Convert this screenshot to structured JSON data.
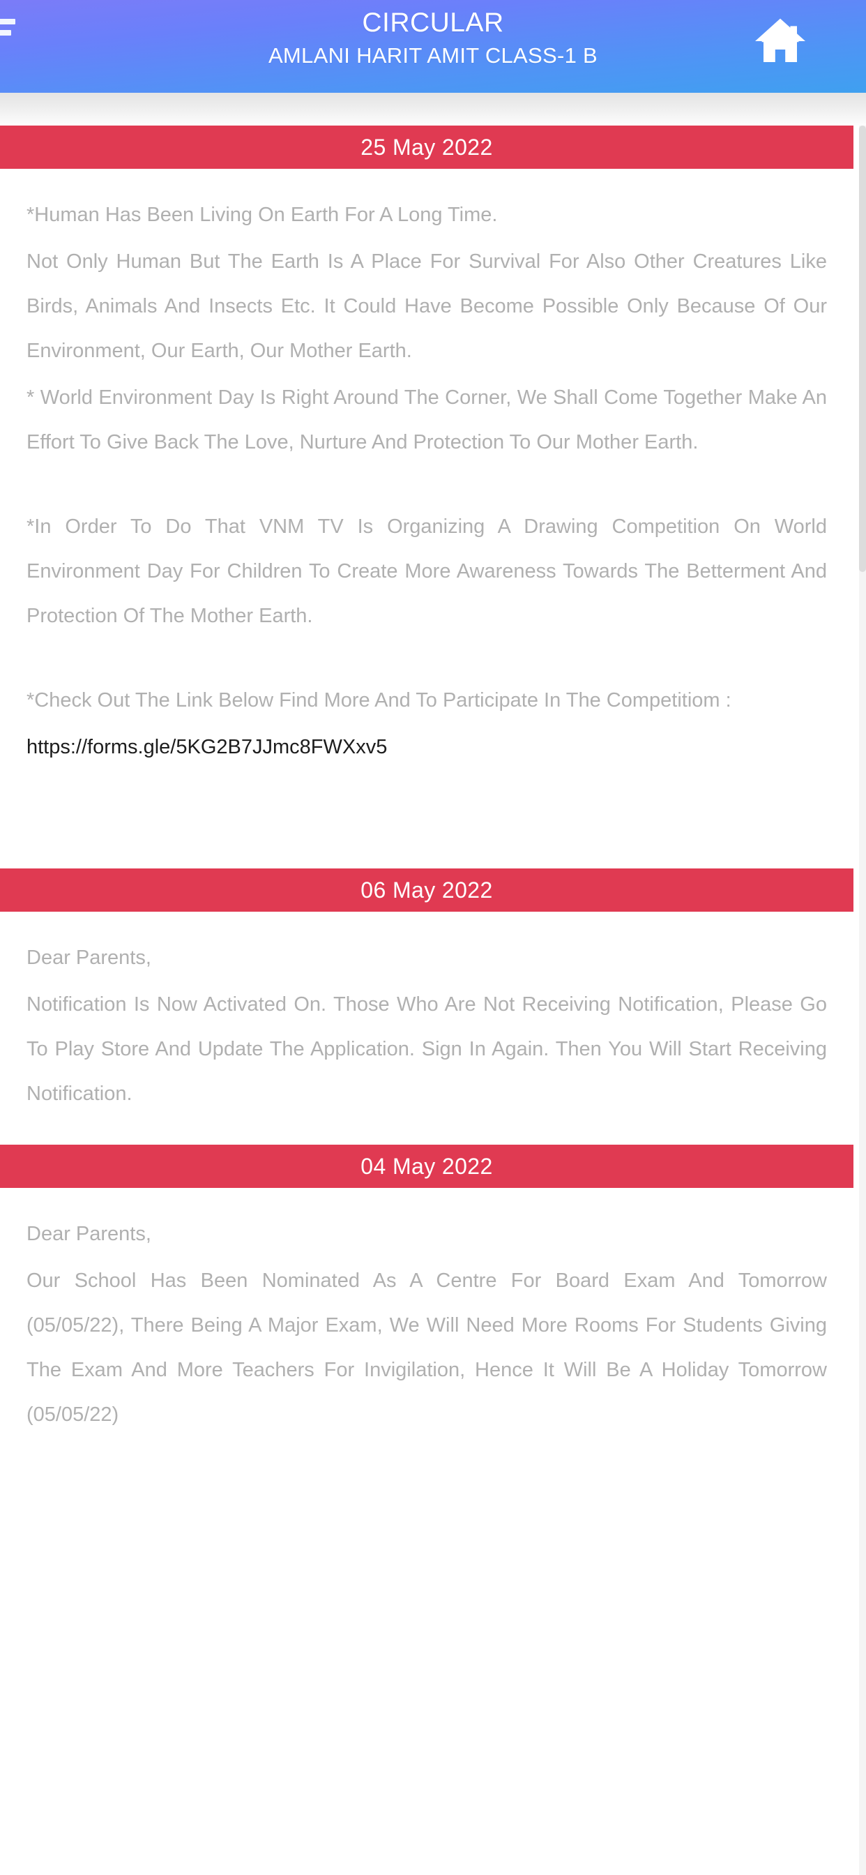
{
  "header": {
    "title": "CIRCULAR",
    "subtitle": "AMLANI HARIT AMIT CLASS-1 B",
    "menu_icon": "hamburger-menu-icon",
    "home_icon": "home-icon",
    "gradient_from": "#7b7cf8",
    "gradient_to": "#3fa0f0"
  },
  "colors": {
    "date_bar": "#e03a52",
    "body_text": "#b0b0b0",
    "link_text": "#1d1d1d",
    "page_background": "#ffffff"
  },
  "circulars": [
    {
      "date": "25 May 2022",
      "paragraphs": [
        "*Human Has Been Living On Earth For A Long Time.",
        "Not Only Human But The Earth Is A Place For Survival For Also Other Creatures Like Birds, Animals And Insects Etc. It Could Have Become Possible Only Because Of Our Environment, Our Earth, Our Mother Earth.",
        "* World Environment Day Is Right Around The Corner, We Shall Come Together Make An Effort To Give Back The Love, Nurture And Protection To Our Mother Earth.",
        "*In Order To Do That VNM TV Is Organizing A Drawing Competition On World Environment Day For Children To Create More Awareness Towards The Betterment And Protection Of The Mother Earth.",
        "*Check Out The Link Below Find More And To Participate In The Competitiom :"
      ],
      "link": "https://forms.gle/5KG2B7JJmc8FWXxv5"
    },
    {
      "date": "06 May 2022",
      "paragraphs": [
        "Dear Parents,",
        "Notification Is Now Activated On.  Those Who Are Not Receiving Notification, Please Go To Play Store And Update The Application. Sign In Again. Then You Will Start Receiving Notification."
      ],
      "link": ""
    },
    {
      "date": "04 May 2022",
      "paragraphs": [
        "Dear Parents,",
        "Our School Has Been Nominated As A Centre For Board Exam And Tomorrow (05/05/22), There Being A Major Exam, We Will Need More Rooms For Students Giving The Exam And More Teachers For Invigilation, Hence It Will Be A Holiday Tomorrow (05/05/22)"
      ],
      "link": ""
    }
  ]
}
